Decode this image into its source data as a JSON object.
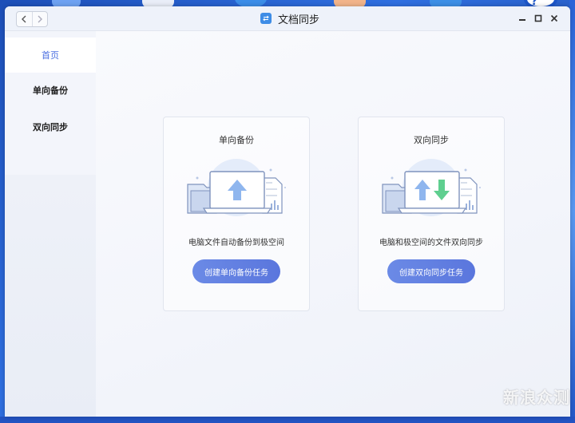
{
  "window": {
    "title": "文档同步"
  },
  "sidebar": {
    "items": [
      {
        "label": "首页"
      },
      {
        "label": "单向备份"
      },
      {
        "label": "双向同步"
      }
    ]
  },
  "cards": [
    {
      "title": "单向备份",
      "description": "电脑文件自动备份到极空间",
      "button": "创建单向备份任务"
    },
    {
      "title": "双向同步",
      "description": "电脑和极空间的文件双向同步",
      "button": "创建双向同步任务"
    }
  ],
  "watermark": "新浪众测",
  "colors": {
    "accent": "#5a76dd",
    "arrow_blue": "#8fb6ee",
    "arrow_green": "#5fcf8f"
  }
}
